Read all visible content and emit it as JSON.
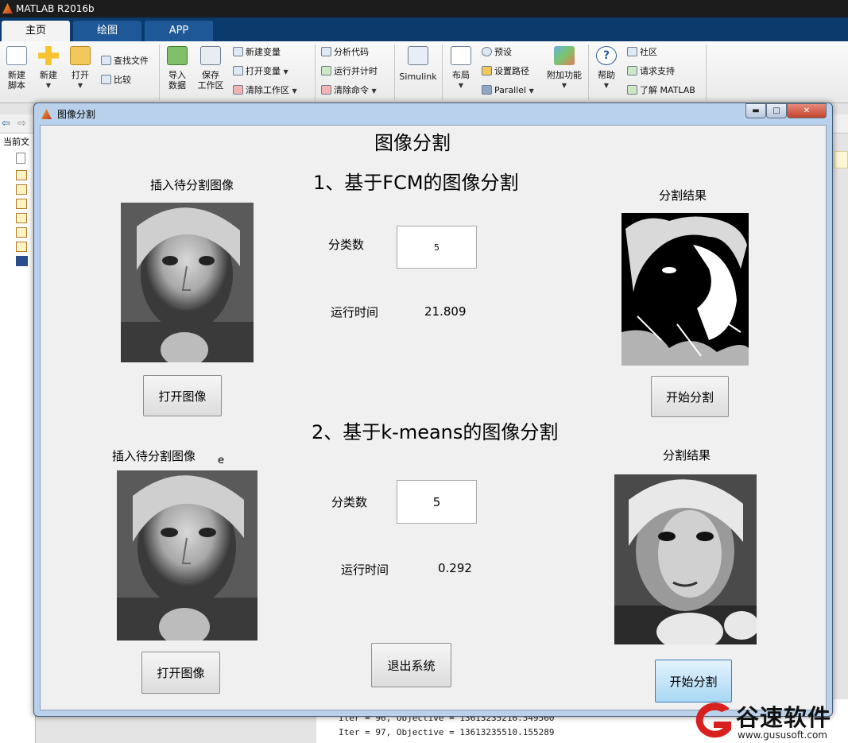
{
  "matlab": {
    "title": "MATLAB R2016b",
    "tabs": [
      "主页",
      "绘图",
      "APP"
    ],
    "ribbon": {
      "new_script": [
        "新建",
        "脚本"
      ],
      "new": "新建",
      "open": "打开",
      "find_files": "查找文件",
      "compare": "比较",
      "import_data": [
        "导入",
        "数据"
      ],
      "save_workspace": [
        "保存",
        "工作区"
      ],
      "new_variable": "新建变量",
      "open_variable": "打开变量",
      "clear_workspace": "清除工作区",
      "analyze_code": "分析代码",
      "run_and_time": "运行并计时",
      "clear_commands": "清除命令",
      "simulink": "Simulink",
      "layout": "布局",
      "preferences": "预设",
      "set_path": "设置路径",
      "parallel": "Parallel",
      "addons": "附加功能",
      "help": "帮助",
      "community": "社区",
      "request_support": "请求支持",
      "learn_matlab": "了解 MATLAB"
    },
    "current_folder_label": "当前文",
    "command_lines": [
      "Iter = 96, Objective = 13613235216.549560",
      "Iter = 97, Objective = 13613235510.155289"
    ]
  },
  "figure": {
    "window_title": "图像分割",
    "window_buttons": {
      "minimize": "▬",
      "maximize": "□",
      "close": "✕"
    },
    "main_title": "图像分割",
    "fcm": {
      "heading": "1、基于FCM的图像分割",
      "input_label": "插入待分割图像",
      "result_label": "分割结果",
      "class_label": "分类数",
      "class_value": "5",
      "time_label": "运行时间",
      "time_value": "21.809",
      "open_button": "打开图像",
      "start_button": "开始分割"
    },
    "kmeans": {
      "heading": "2、基于k-means的图像分割",
      "input_label": "插入待分割图像",
      "input_label_overlap": "e",
      "result_label": "分割结果",
      "class_label": "分类数",
      "class_value": "5",
      "time_label": "运行时间",
      "time_value": "0.292",
      "open_button": "打开图像",
      "start_button": "开始分割"
    },
    "exit_button": "退出系统"
  },
  "watermark": {
    "brand": "谷速软件",
    "url": "www.gususoft.com"
  },
  "colors": {
    "matlab_tab_bar": "#0b3b6d",
    "window_frame": "#b9d1ea",
    "client_bg": "#f0f0f0",
    "watermark_red": "#d8201f"
  }
}
